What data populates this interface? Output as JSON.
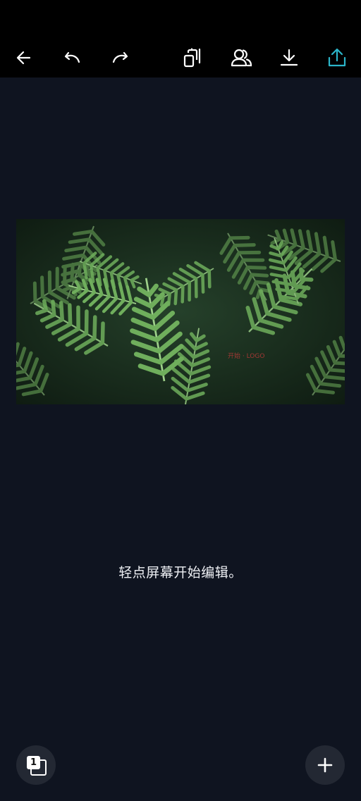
{
  "toolbar": {
    "back_icon": "arrow-left-icon",
    "undo_icon": "undo-icon",
    "redo_icon": "redo-icon",
    "layers_icon": "layers-icon",
    "collaborators_icon": "people-icon",
    "download_icon": "download-icon",
    "share_icon": "share-upload-icon",
    "accent_color": "#2bb5c9"
  },
  "canvas": {
    "image_subject": "fern-leaves-photo",
    "watermark_text": "开始 · LOGO"
  },
  "hint": {
    "text": "轻点屏幕开始编辑。"
  },
  "bottom": {
    "page_count": "1",
    "add_icon": "plus-icon"
  }
}
